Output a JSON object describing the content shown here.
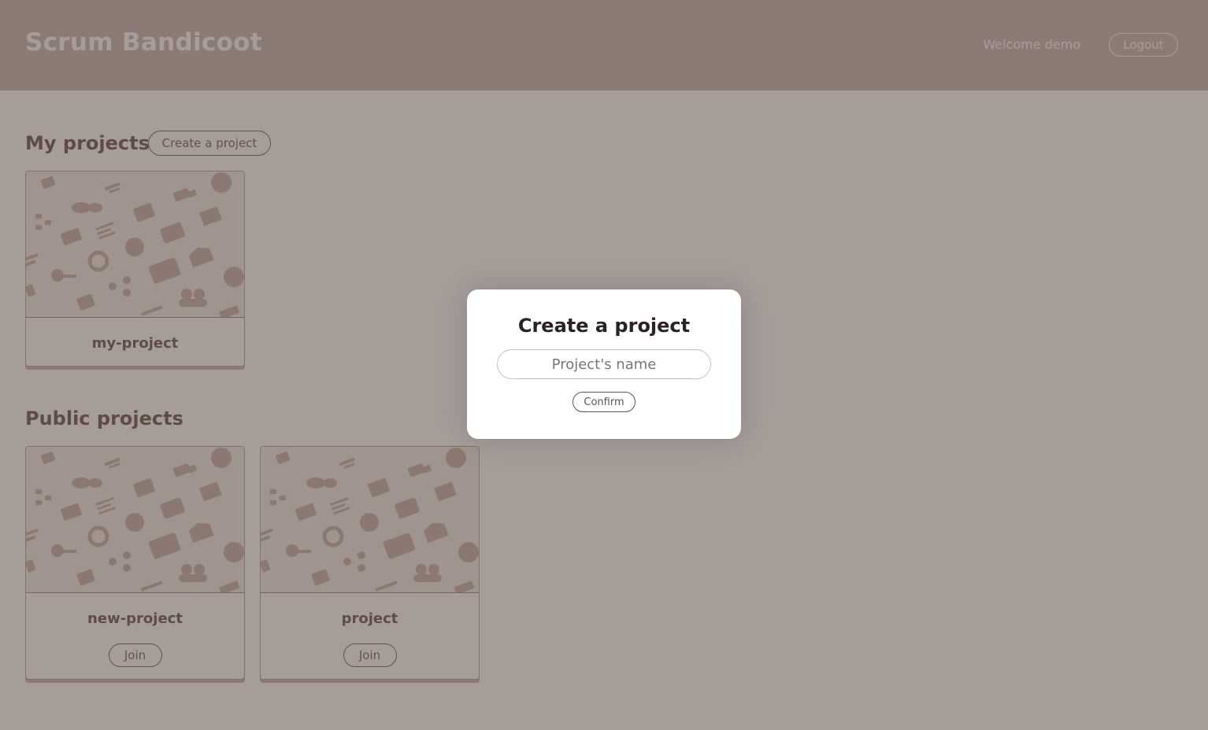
{
  "header": {
    "app_title": "Scrum Bandicoot",
    "welcome_text": "Welcome demo",
    "logout_label": "Logout"
  },
  "my_projects": {
    "title": "My projects",
    "create_label": "Create a project",
    "items": [
      {
        "name": "my-project"
      }
    ]
  },
  "public_projects": {
    "title": "Public projects",
    "items": [
      {
        "name": "new-project",
        "join_label": "Join"
      },
      {
        "name": "project",
        "join_label": "Join"
      }
    ]
  },
  "modal": {
    "title": "Create a project",
    "input_placeholder": "Project's name",
    "confirm_label": "Confirm"
  },
  "colors": {
    "header_bg": "#cbbdb6",
    "overlay": "rgba(78,58,50,0.5)",
    "pattern_icon": "#c9b8b1"
  }
}
